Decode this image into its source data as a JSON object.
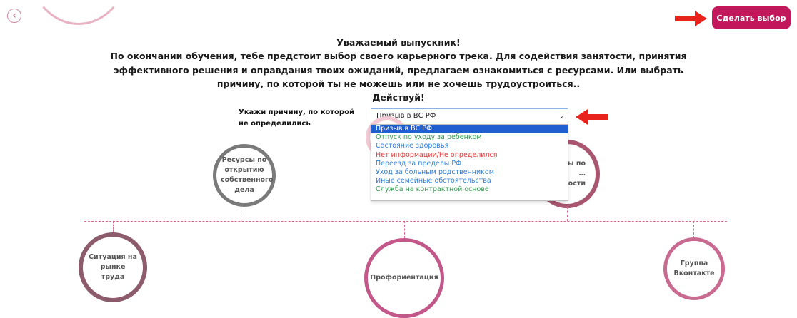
{
  "nav": {
    "back_icon": "chevron-left-icon"
  },
  "actions": {
    "make_choice_label": "Сделать выбор"
  },
  "message": {
    "title": "Уважаемый выпускник!",
    "lines": [
      "По окончании обучения, тебе предстоит выбор своего карьерного трека. Для содействия занятости, принятия",
      "эффективного решения и оправдания твоих ожиданий, предлагаем ознакомиться с ресурсами. Или выбрать",
      "причину, по которой ты не можешь или не хочешь трудоустроиться..",
      "Действуй!"
    ]
  },
  "reason": {
    "label": "Укажи причину, по которой не определились",
    "selected": "Призыв в ВС РФ",
    "options": [
      {
        "text": "Призыв в ВС РФ",
        "color": "#ffffff"
      },
      {
        "text": "Отпуск по уходу за ребенком",
        "color": "#2e9e4f"
      },
      {
        "text": "Состояние здоровья",
        "color": "#2f7fd6"
      },
      {
        "text": "Нет информации/Не определился",
        "color": "#e03c3c"
      },
      {
        "text": "Переезд за пределы РФ",
        "color": "#2f7fd6"
      },
      {
        "text": "Уход за больным родственником",
        "color": "#2f7fd6"
      },
      {
        "text": "Иные семейные обстоятельства",
        "color": "#2f7fd6"
      },
      {
        "text": "Служба на контрактной основе",
        "color": "#2e9e4f"
      }
    ]
  },
  "circles": {
    "own_business": "Ресурсы по открытию собственного дела",
    "employment_partial": "…ы по …ятости",
    "labor_market": "Ситуация на рынке труда",
    "career_guidance": "Профориентация",
    "vk_group": "Группа Вконтакте"
  },
  "colors": {
    "accent": "#c2185b",
    "arrow": "#e8221c",
    "select_highlight": "#1f5fcf"
  }
}
